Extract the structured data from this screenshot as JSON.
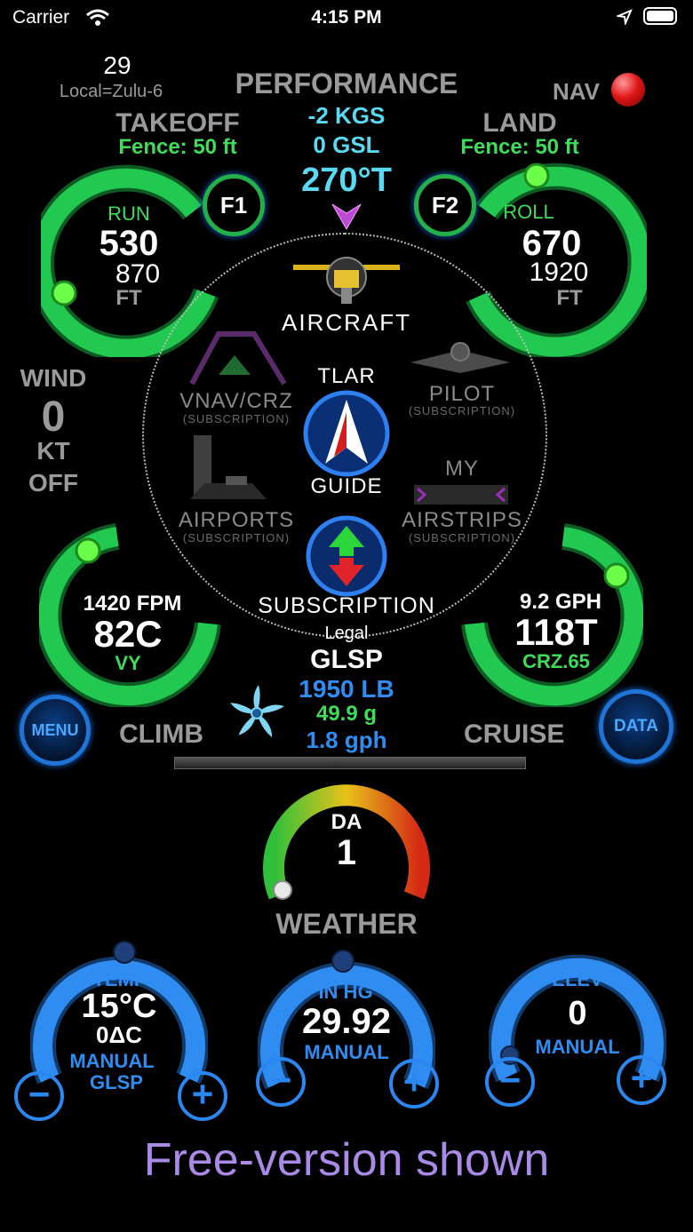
{
  "status_bar": {
    "carrier": "Carrier",
    "time": "4:15 PM"
  },
  "header": {
    "day": "29",
    "timezone": "Local=Zulu-6",
    "title": "PERFORMANCE",
    "nav_label": "NAV"
  },
  "wind_course": {
    "ground_speed": "-2 KGS",
    "gsl": "0 GSL",
    "heading": "270°T"
  },
  "takeoff": {
    "title": "TAKEOFF",
    "fence": "Fence: 50 ft",
    "button": "F1",
    "label": "RUN",
    "value": "530",
    "subvalue": "870",
    "unit": "FT"
  },
  "landing": {
    "title": "LAND",
    "fence": "Fence: 50 ft",
    "button": "F2",
    "label": "ROLL",
    "value": "670",
    "subvalue": "1920",
    "unit": "FT"
  },
  "wind": {
    "label": "WIND",
    "value": "0",
    "unit": "KT",
    "state": "OFF"
  },
  "menu_wheel": {
    "aircraft": "AIRCRAFT",
    "vnav": "VNAV/CRZ",
    "vnav_sub": "(SUBSCRIPTION)",
    "pilot": "PILOT",
    "pilot_sub": "(SUBSCRIPTION)",
    "tlar": "TLAR",
    "guide": "GUIDE",
    "airports": "AIRPORTS",
    "airports_sub": "(SUBSCRIPTION)",
    "my": "MY",
    "airstrips": "AIRSTRIPS",
    "airstrips_sub": "(SUBSCRIPTION)",
    "subscription": "SUBSCRIPTION"
  },
  "climb": {
    "rate": "1420 FPM",
    "speed": "82C",
    "speed_type": "VY",
    "label": "CLIMB"
  },
  "cruise": {
    "fuel_flow": "9.2 GPH",
    "speed": "118T",
    "power": "CRZ.65",
    "label": "CRUISE"
  },
  "weight": {
    "status": "Legal",
    "type": "GLSP",
    "weight": "1950 LB",
    "fuel": "49.9 g",
    "burn": "1.8 gph"
  },
  "buttons": {
    "menu": "MENU",
    "data": "DATA"
  },
  "density_altitude": {
    "label": "DA",
    "value": "1"
  },
  "weather": {
    "title": "WEATHER"
  },
  "temp": {
    "label": "TEMP",
    "value": "15°C",
    "delta": "0ΔC",
    "mode": "MANUAL",
    "type": "GLSP"
  },
  "altimeter": {
    "label": "IN HG",
    "value": "29.92",
    "mode": "MANUAL"
  },
  "elevation": {
    "label": "ELEV",
    "value": "0",
    "mode": "MANUAL"
  },
  "controls": {
    "minus": "−",
    "plus": "+"
  },
  "footer": {
    "note": "Free-version shown"
  },
  "colors": {
    "accent_green": "#3fdc5a",
    "accent_blue": "#2f8df2",
    "heading_cyan": "#59d9f2",
    "footer_purple": "#a98ae6",
    "nav_red": "#e01818"
  }
}
